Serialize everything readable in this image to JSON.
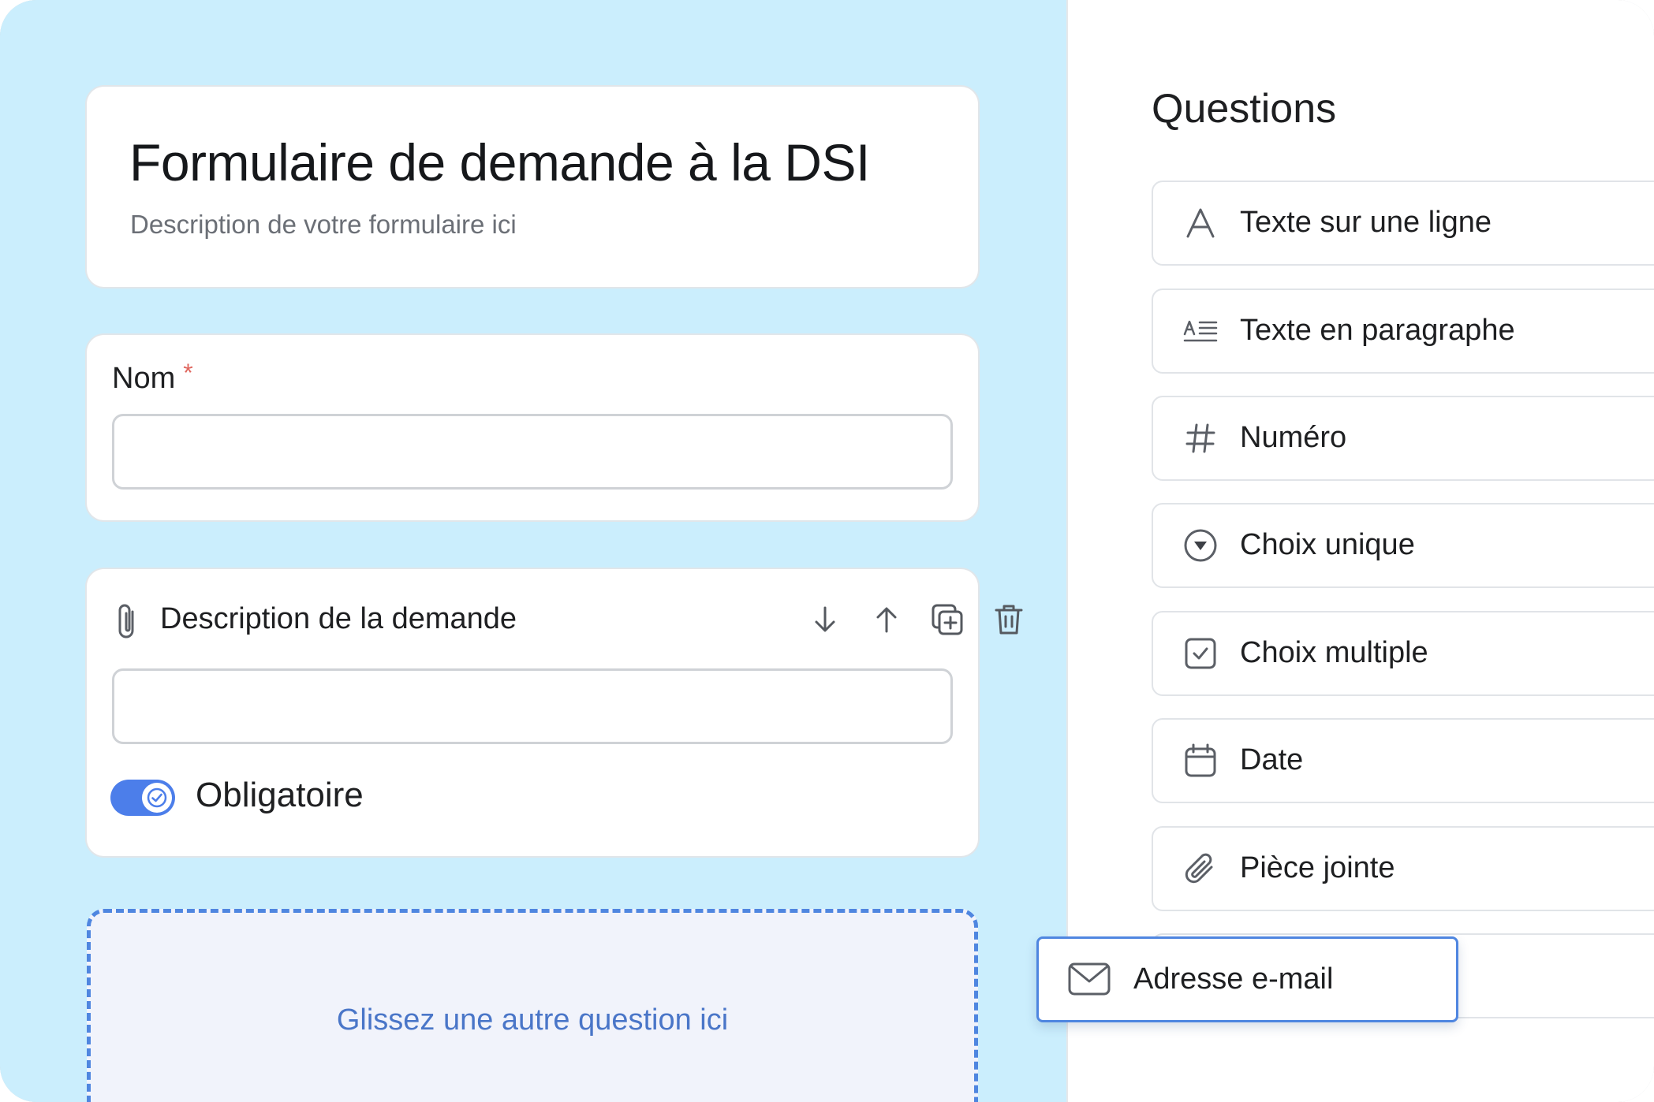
{
  "form": {
    "title": "Formulaire de demande à la DSI",
    "description": "Description de votre formulaire ici"
  },
  "fields": {
    "nom": {
      "label": "Nom",
      "required_marker": "*",
      "value": ""
    },
    "description": {
      "label": "Description de la demande",
      "value": "",
      "required_toggle": {
        "label": "Obligatoire",
        "on": true
      }
    }
  },
  "dropzone": {
    "text": "Glissez une autre question ici"
  },
  "questions_panel": {
    "title": "Questions",
    "items": [
      {
        "label": "Texte sur une ligne",
        "icon": "letter-a-icon"
      },
      {
        "label": "Texte en paragraphe",
        "icon": "paragraph-text-icon"
      },
      {
        "label": "Numéro",
        "icon": "hash-icon"
      },
      {
        "label": "Choix unique",
        "icon": "dropdown-circle-icon"
      },
      {
        "label": "Choix multiple",
        "icon": "checkbox-icon"
      },
      {
        "label": "Date",
        "icon": "calendar-icon"
      },
      {
        "label": "Pièce jointe",
        "icon": "paperclip-icon"
      }
    ],
    "dragging_item": {
      "label": "Adresse e-mail",
      "icon": "envelope-icon"
    }
  },
  "colors": {
    "left_background": "#cbeefd",
    "accent": "#4c7eea",
    "required": "#e0675f",
    "dropzone_border": "#4f86e0"
  }
}
